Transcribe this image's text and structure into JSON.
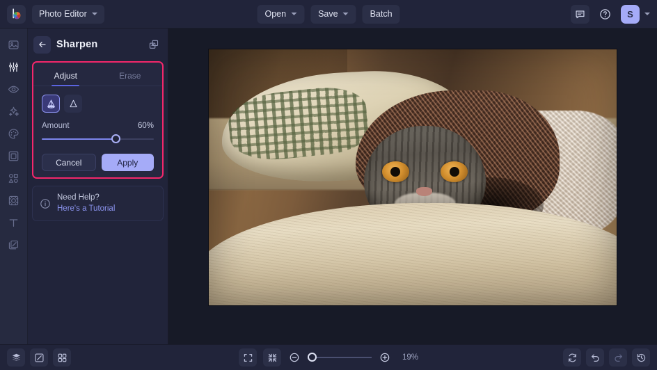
{
  "topbar": {
    "logo_name": "color-wheel-logo",
    "app_switcher_label": "Photo Editor",
    "open_label": "Open",
    "save_label": "Save",
    "batch_label": "Batch",
    "feedback_icon": "chat-bubble-icon",
    "help_icon": "question-circle-icon",
    "avatar_initial": "S"
  },
  "rail": {
    "items": [
      {
        "icon": "image-icon",
        "name": "sidebar-item-image",
        "active": false
      },
      {
        "icon": "sliders-icon",
        "name": "sidebar-item-adjust",
        "active": true
      },
      {
        "icon": "eye-icon",
        "name": "sidebar-item-retouch",
        "active": false
      },
      {
        "icon": "sparkles-icon",
        "name": "sidebar-item-effects",
        "active": false
      },
      {
        "icon": "palette-icon",
        "name": "sidebar-item-colors",
        "active": false
      },
      {
        "icon": "frame-icon",
        "name": "sidebar-item-frames",
        "active": false
      },
      {
        "icon": "shapes-icon",
        "name": "sidebar-item-elements",
        "active": false
      },
      {
        "icon": "crop-icon",
        "name": "sidebar-item-crop",
        "active": false
      },
      {
        "icon": "text-icon",
        "name": "sidebar-item-text",
        "active": false
      },
      {
        "icon": "layers-icon",
        "name": "sidebar-item-layers",
        "active": false
      }
    ]
  },
  "panel": {
    "back_icon": "arrow-left-icon",
    "title": "Sharpen",
    "duplicate_icon": "duplicate-layers-icon",
    "tabs": [
      {
        "label": "Adjust",
        "active": true
      },
      {
        "label": "Erase",
        "active": false
      }
    ],
    "modes": [
      {
        "icon": "sharpen-cone-filled-icon",
        "selected": true
      },
      {
        "icon": "sharpen-cone-outline-icon",
        "selected": false
      }
    ],
    "slider": {
      "label": "Amount",
      "value_label": "60%",
      "value": 60
    },
    "cancel_label": "Cancel",
    "apply_label": "Apply",
    "help": {
      "icon": "info-circle-icon",
      "line1": "Need Help?",
      "line2": "Here's a Tutorial"
    },
    "highlight_color": "#f4276b"
  },
  "bottombar": {
    "left_icons": [
      {
        "icon": "layers-stack-icon",
        "name": "layers-panel-button"
      },
      {
        "icon": "compare-split-icon",
        "name": "compare-button"
      },
      {
        "icon": "grid-icon",
        "name": "grid-view-button"
      }
    ],
    "fit_icon": "fit-screen-icon",
    "actual_icon": "shrink-icon",
    "zoom_out_icon": "minus-circle-icon",
    "zoom_in_icon": "plus-circle-icon",
    "zoom_level": "19%",
    "zoom_value": 4,
    "right_icons": [
      {
        "icon": "reset-icon",
        "name": "reset-button",
        "dim": false
      },
      {
        "icon": "undo-icon",
        "name": "undo-button",
        "dim": false
      },
      {
        "icon": "redo-icon",
        "name": "redo-button",
        "dim": true
      },
      {
        "icon": "history-icon",
        "name": "history-button",
        "dim": false
      }
    ]
  },
  "canvas": {
    "image_alt": "cat-under-blanket-photo"
  },
  "colors": {
    "accent": "#a5abf8",
    "highlight": "#f4276b",
    "panel_bg": "#21243a",
    "canvas_bg": "#171a27"
  }
}
